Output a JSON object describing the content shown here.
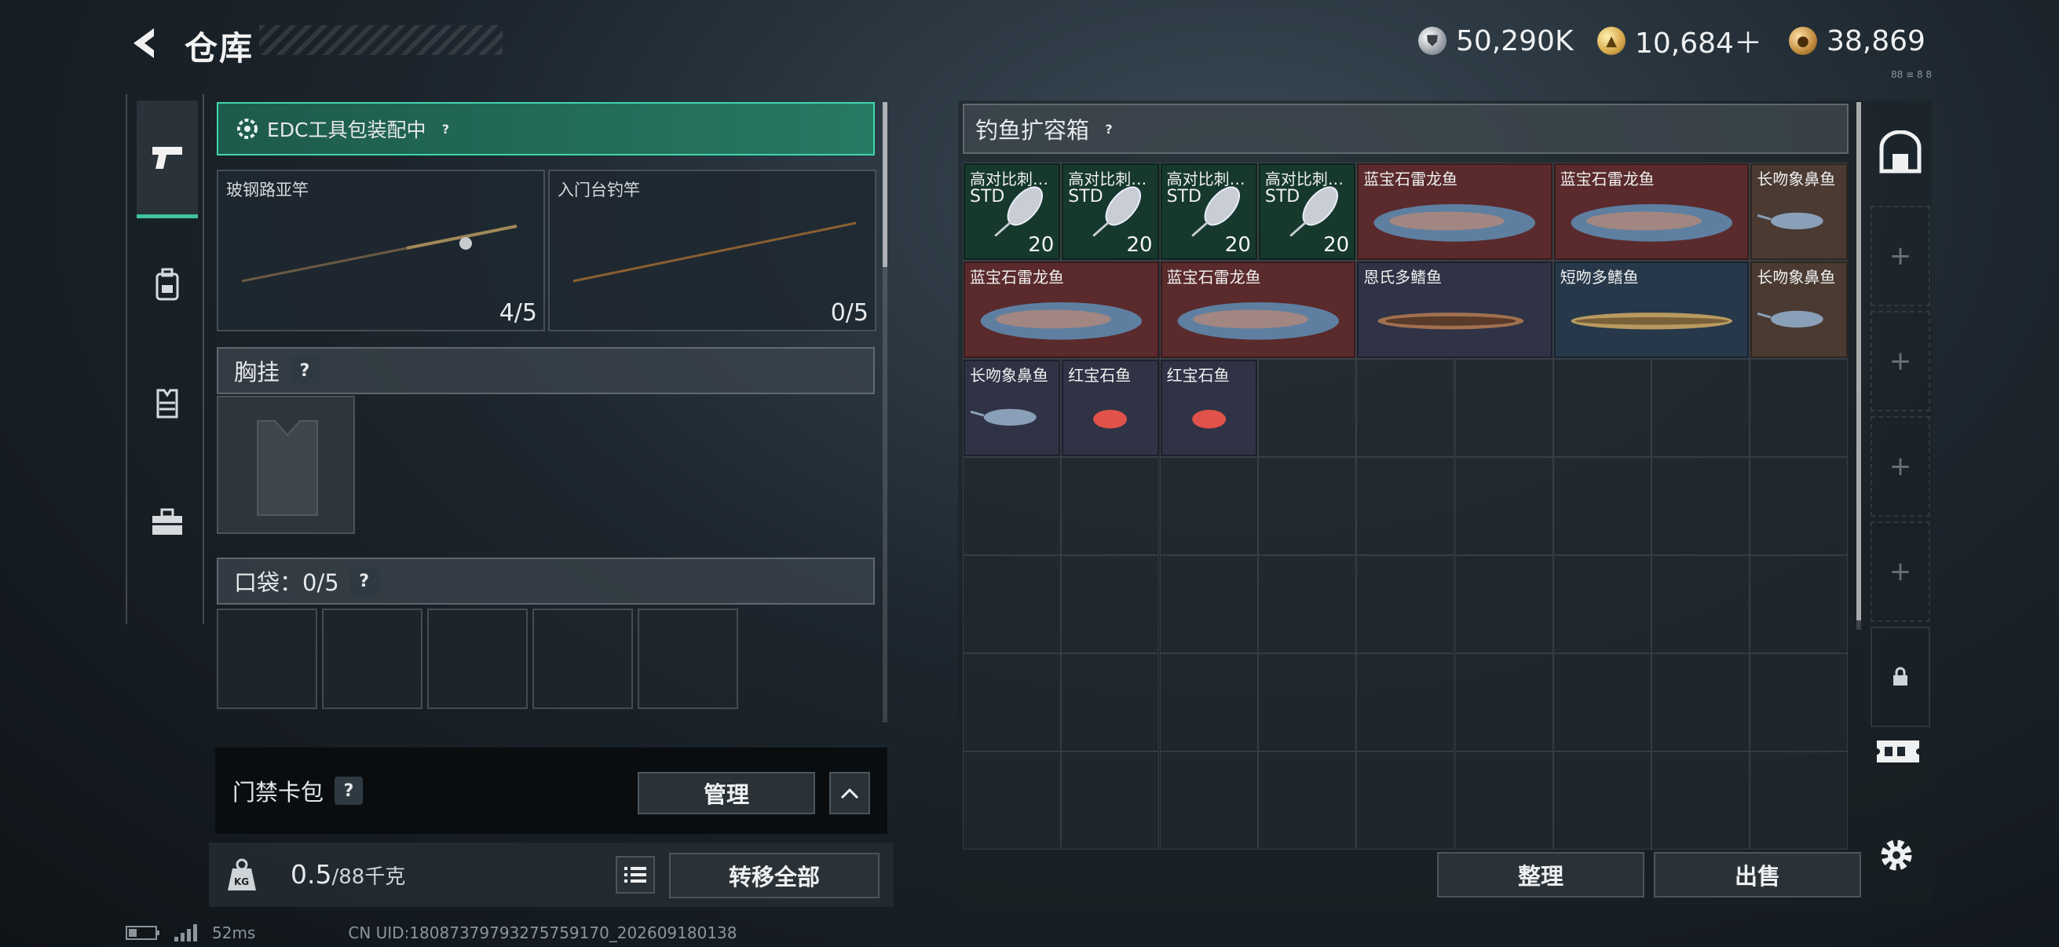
{
  "header": {
    "title": "仓库",
    "currencies": [
      {
        "value": "50,290K",
        "icon": "silver-coin-icon"
      },
      {
        "value": "10,684＋",
        "icon": "gold-coin-icon"
      },
      {
        "value": "38,869",
        "icon": "bronze-coin-icon"
      }
    ],
    "tiny_label": "88 ≡ 8 8"
  },
  "nav": {
    "items": [
      "pistol-icon",
      "backpack-icon",
      "vest-icon",
      "toolbox-icon"
    ]
  },
  "edc": {
    "label": "EDC工具包装配中",
    "help": "?"
  },
  "rods": [
    {
      "label": "玻钢路亚竿",
      "count": "4/5"
    },
    {
      "label": "入门台钓竿",
      "count": "0/5"
    }
  ],
  "chest": {
    "label": "胸挂",
    "help": "?"
  },
  "pocket": {
    "label": "口袋：0/5",
    "help": "?"
  },
  "card_pack": {
    "label": "门禁卡包",
    "help": "?",
    "manage": "管理"
  },
  "weight": {
    "current": "0.5",
    "max": "/88千克",
    "icon_text": "KG",
    "transfer": "转移全部"
  },
  "box": {
    "title": "钓鱼扩容箱",
    "help": "?"
  },
  "items": [
    {
      "name": "高对比刺…",
      "sub": "STD",
      "qty": "20",
      "kind": "lure"
    },
    {
      "name": "高对比刺…",
      "sub": "STD",
      "qty": "20",
      "kind": "lure"
    },
    {
      "name": "高对比刺…",
      "sub": "STD",
      "qty": "20",
      "kind": "lure"
    },
    {
      "name": "高对比刺…",
      "sub": "STD",
      "qty": "20",
      "kind": "lure"
    },
    {
      "name": "蓝宝石雷龙鱼",
      "kind": "red"
    },
    {
      "name": "蓝宝石雷龙鱼",
      "kind": "red"
    },
    {
      "name": "长吻象鼻鱼",
      "kind": "brown"
    },
    {
      "name": "蓝宝石雷龙鱼",
      "kind": "red"
    },
    {
      "name": "蓝宝石雷龙鱼",
      "kind": "red"
    },
    {
      "name": "恩氏多鳍鱼",
      "kind": "purple"
    },
    {
      "name": "短吻多鳍鱼",
      "kind": "blue"
    },
    {
      "name": "长吻象鼻鱼",
      "kind": "brown"
    },
    {
      "name": "长吻象鼻鱼",
      "kind": "purple"
    },
    {
      "name": "红宝石鱼",
      "kind": "purple"
    },
    {
      "name": "红宝石鱼",
      "kind": "purple"
    }
  ],
  "actions": {
    "sort": "整理",
    "sell": "出售"
  },
  "rail": {
    "slots": [
      "+",
      "+",
      "+",
      "+"
    ]
  },
  "footer": {
    "ping": "52ms",
    "uid": "CN UID:18087379793275759170_202609180138"
  }
}
